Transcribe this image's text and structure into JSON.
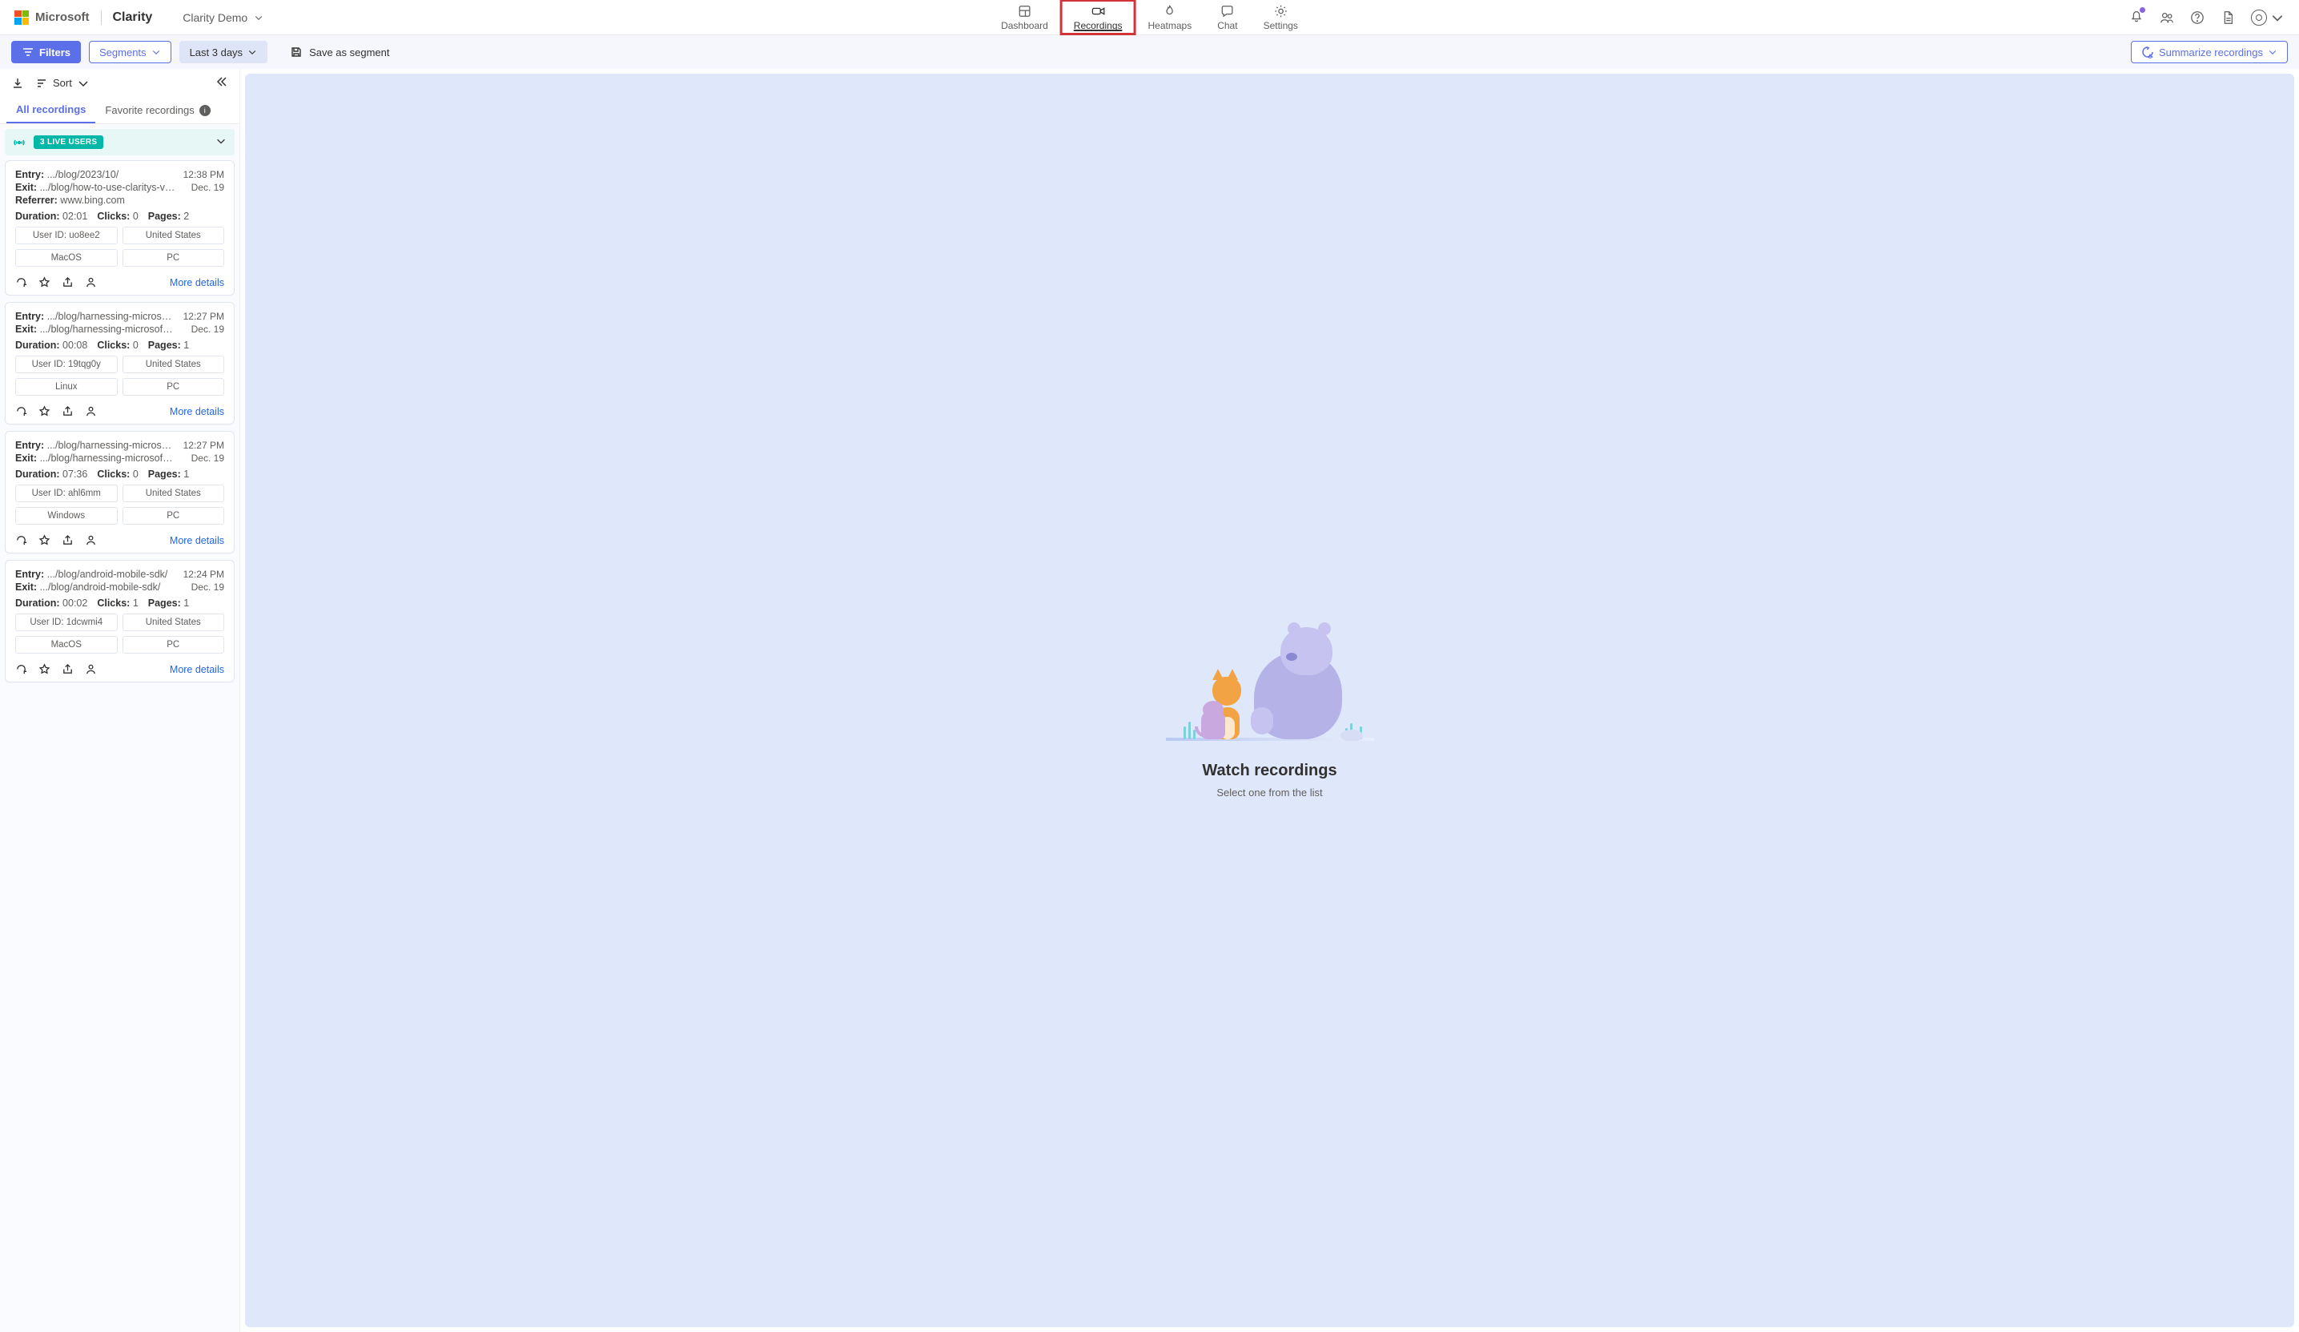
{
  "header": {
    "brand": "Microsoft",
    "product": "Clarity",
    "project": "Clarity Demo"
  },
  "nav": {
    "dashboard": "Dashboard",
    "recordings": "Recordings",
    "heatmaps": "Heatmaps",
    "chat": "Chat",
    "settings": "Settings"
  },
  "toolbar": {
    "filters": "Filters",
    "segments": "Segments",
    "date_range": "Last 3 days",
    "save_segment": "Save as segment",
    "summarize": "Summarize recordings"
  },
  "sidebar": {
    "sort_label": "Sort",
    "tab_all": "All recordings",
    "tab_fav": "Favorite recordings",
    "live_users": "3 LIVE USERS",
    "more_details": "More details"
  },
  "recordings": [
    {
      "entry": ".../blog/2023/10/",
      "exit": ".../blog/how-to-use-claritys-visitor-p...",
      "referrer": "www.bing.com",
      "duration": "02:01",
      "clicks": "0",
      "pages": "2",
      "time": "12:38 PM",
      "date": "Dec. 19",
      "user_id": "User ID: uo8ee2",
      "country": "United States",
      "os": "MacOS",
      "device": "PC"
    },
    {
      "entry": ".../blog/harnessing-microsoft-clarit...",
      "exit": ".../blog/harnessing-microsoft-clarity-...",
      "duration": "00:08",
      "clicks": "0",
      "pages": "1",
      "time": "12:27 PM",
      "date": "Dec. 19",
      "user_id": "User ID: 19tqg0y",
      "country": "United States",
      "os": "Linux",
      "device": "PC"
    },
    {
      "entry": ".../blog/harnessing-microsoft-clarit...",
      "exit": ".../blog/harnessing-microsoft-clarity-...",
      "duration": "07:36",
      "clicks": "0",
      "pages": "1",
      "time": "12:27 PM",
      "date": "Dec. 19",
      "user_id": "User ID: ahl6mm",
      "country": "United States",
      "os": "Windows",
      "device": "PC"
    },
    {
      "entry": ".../blog/android-mobile-sdk/",
      "exit": ".../blog/android-mobile-sdk/",
      "duration": "00:02",
      "clicks": "1",
      "pages": "1",
      "time": "12:24 PM",
      "date": "Dec. 19",
      "user_id": "User ID: 1dcwmi4",
      "country": "United States",
      "os": "MacOS",
      "device": "PC"
    }
  ],
  "content": {
    "heading": "Watch recordings",
    "sub": "Select one from the list"
  },
  "labels": {
    "entry": "Entry:",
    "exit": "Exit:",
    "referrer": "Referrer:",
    "duration": "Duration:",
    "clicks": "Clicks:",
    "pages": "Pages:"
  }
}
